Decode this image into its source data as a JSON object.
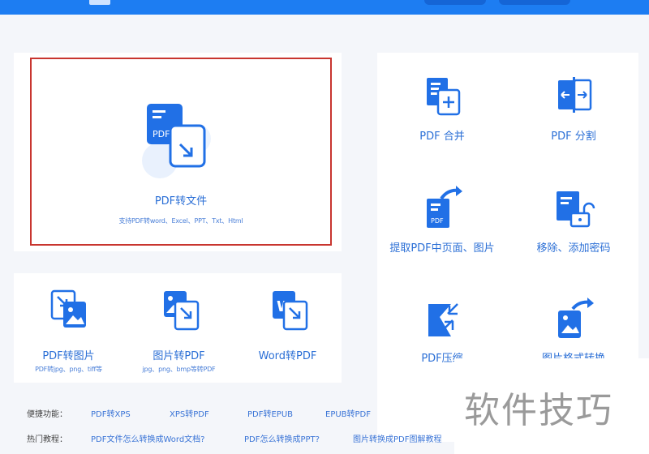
{
  "colors": {
    "accent": "#2f6fd8",
    "topbar": "#1d7df2",
    "highlight_border": "#c8352f"
  },
  "main_tool": {
    "title": "PDF转文件",
    "subtitle": "支持PDF转word、Excel、PPT、Txt、Html",
    "icon_text": "PDF"
  },
  "right_tools": [
    {
      "label": "PDF 合并",
      "icon": "pdf-merge-icon"
    },
    {
      "label": "PDF 分割",
      "icon": "pdf-split-icon"
    },
    {
      "label": "提取PDF中页面、图片",
      "icon": "pdf-extract-icon",
      "icon_text": "PDF"
    },
    {
      "label": "移除、添加密码",
      "icon": "pdf-password-icon"
    },
    {
      "label": "PDF压缩",
      "icon": "pdf-compress-icon"
    },
    {
      "label": "图片格式转换",
      "icon": "image-convert-icon"
    }
  ],
  "bottom_tools": [
    {
      "label": "PDF转图片",
      "sub": "PDF转jpg、png、tiff等",
      "icon": "pdf-to-image-icon"
    },
    {
      "label": "图片转PDF",
      "sub": "jpg、png、bmp等转PDF",
      "icon": "image-to-pdf-icon"
    },
    {
      "label": "Word转PDF",
      "sub": "",
      "icon": "word-to-pdf-icon",
      "icon_text": "W"
    }
  ],
  "quick_links": {
    "label": "便捷功能：",
    "items": [
      "PDF转XPS",
      "XPS转PDF",
      "PDF转EPUB",
      "EPUB转PDF"
    ]
  },
  "hot_tutorials": {
    "label": "热门教程：",
    "items": [
      "PDF文件怎么转换成Word文档?",
      "PDF怎么转换成PPT?",
      "图片转换成PDF图解教程"
    ]
  },
  "watermark": "软件技巧"
}
